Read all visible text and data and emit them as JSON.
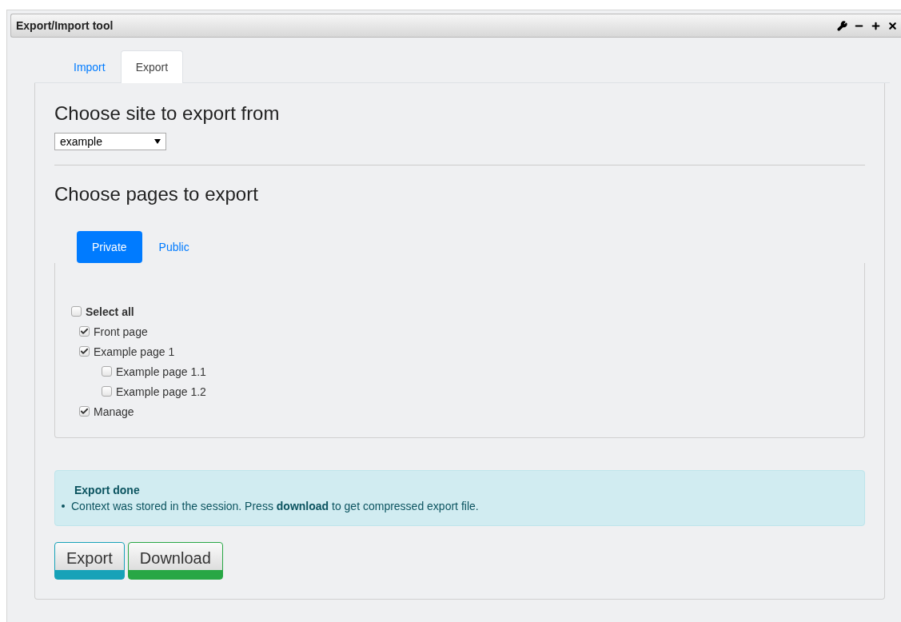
{
  "window": {
    "title": "Export/Import tool"
  },
  "tabs": [
    {
      "label": "Import",
      "selected": false
    },
    {
      "label": "Export",
      "selected": true
    }
  ],
  "site_section": {
    "heading": "Choose site to export from",
    "site_select": {
      "value": "example"
    }
  },
  "pages_section": {
    "heading": "Choose pages to export",
    "tabs": [
      {
        "label": "Private",
        "selected": true
      },
      {
        "label": "Public",
        "selected": false
      }
    ],
    "select_all": {
      "label": "Select all",
      "checked": false
    },
    "pages": [
      {
        "label": "Front page",
        "checked": true
      },
      {
        "label": "Example page 1",
        "checked": true,
        "children": [
          {
            "label": "Example page 1.1",
            "checked": false
          },
          {
            "label": "Example page 1.2",
            "checked": false
          }
        ]
      },
      {
        "label": "Manage",
        "checked": true
      }
    ]
  },
  "alert": {
    "title": "Export done",
    "messages": [
      "Context was stored in the session. Press **download** to get compressed export file."
    ]
  },
  "buttons": [
    {
      "label": "Export",
      "color": "#17a2b8"
    },
    {
      "label": "Download",
      "color": "#28a745"
    }
  ]
}
